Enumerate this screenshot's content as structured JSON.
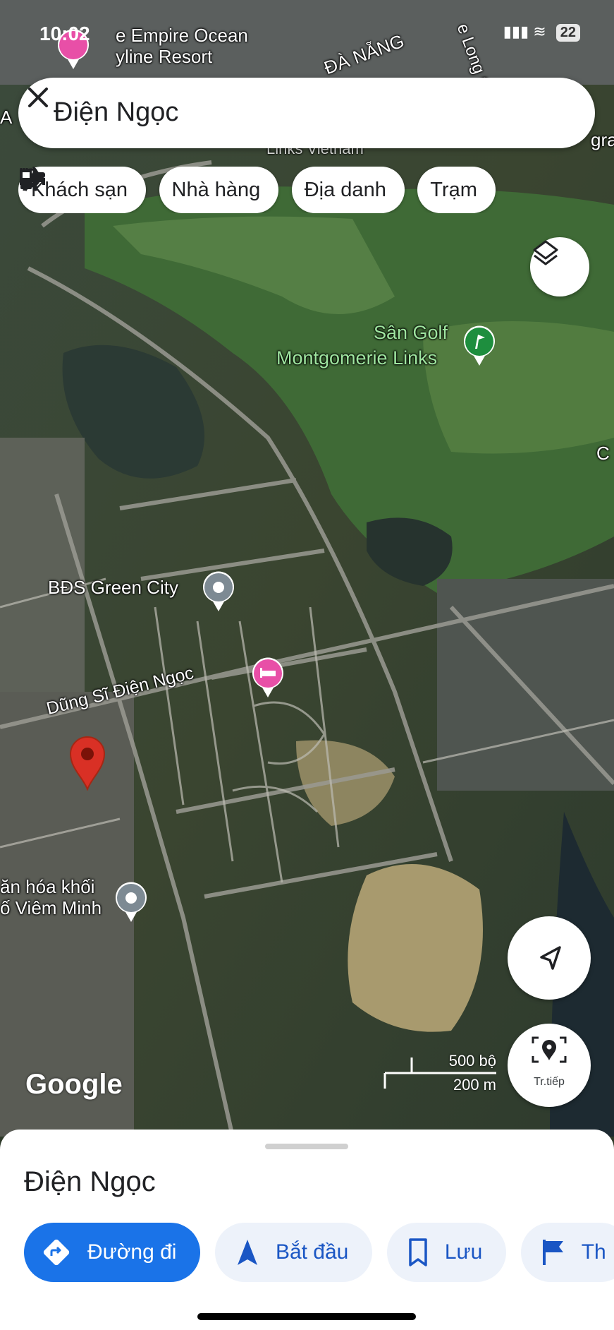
{
  "status_bar": {
    "time": "10:02",
    "battery": "22"
  },
  "search": {
    "query": "Điện Ngọc"
  },
  "chips": [
    {
      "label": "Khách sạn",
      "icon": "hotel-icon"
    },
    {
      "label": "Nhà hàng",
      "icon": "restaurant-icon"
    },
    {
      "label": "Địa danh",
      "icon": "landmark-icon"
    },
    {
      "label": "Trạm",
      "icon": "gas-station-icon"
    }
  ],
  "map_labels": {
    "resort_line1": "e Empire Ocean",
    "resort_line2": "yline Resort",
    "region": "ĐÀ NẴNG",
    "road_top": "e Long Qu",
    "gram": "gram",
    "links_vietnam": "Links Vietnam",
    "golf_line1": "Sân Golf",
    "golf_line2": "Montgomerie Links",
    "edge_c": "C",
    "green_city": "BĐS Green City",
    "road_name": "Dũng Sĩ Điện Ngọc",
    "culture_line1": "ăn hóa khối",
    "culture_line2": "ố Viêm Minh",
    "edge_a": "A"
  },
  "scale": {
    "feet": "500 bộ",
    "meters": "200 m"
  },
  "google_logo": "Google",
  "directions_fab": {
    "label": "Tr.tiếp"
  },
  "sheet": {
    "title": "Điện Ngọc",
    "actions": [
      {
        "label": "Đường đi",
        "icon": "directions-icon",
        "primary": true
      },
      {
        "label": "Bắt đầu",
        "icon": "navigation-arrow-icon"
      },
      {
        "label": "Lưu",
        "icon": "bookmark-icon"
      },
      {
        "label": "Th",
        "icon": "flag-icon"
      }
    ]
  },
  "colors": {
    "accent": "#1a73e8",
    "pin_red": "#d93025",
    "poi_pink": "#e84fa7",
    "golf_green": "#1e8e3e"
  }
}
